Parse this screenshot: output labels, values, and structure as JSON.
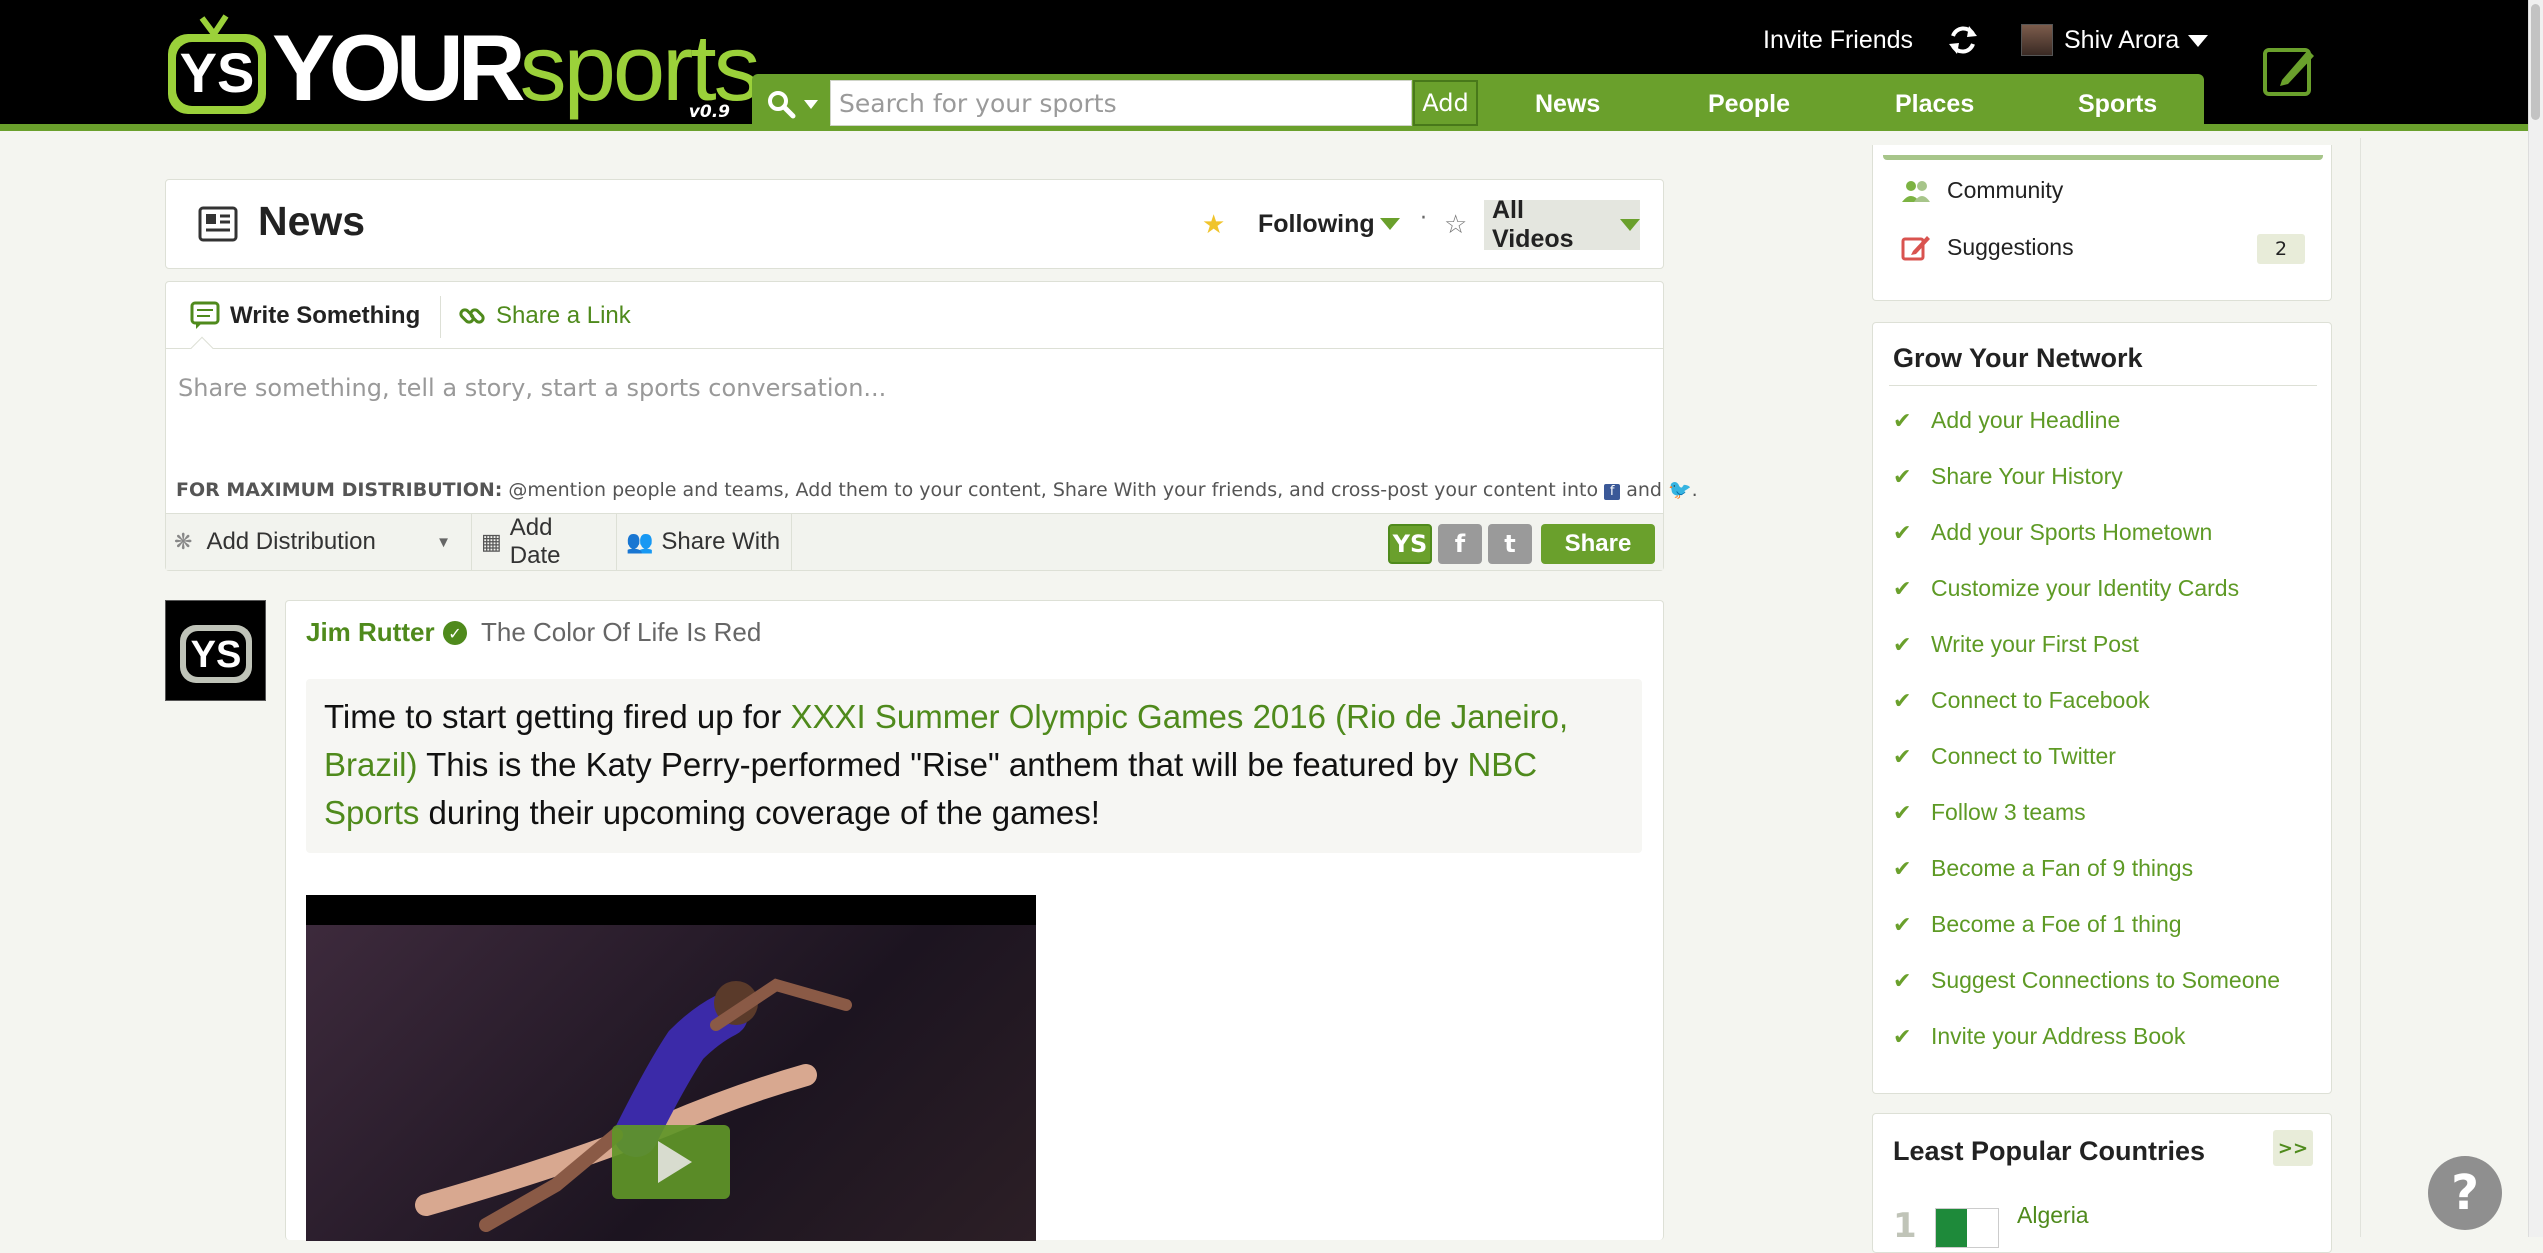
{
  "header": {
    "logo_your": "YOUR",
    "logo_sports": "sports",
    "logo_version": "v0.9",
    "search_placeholder": "Search for your sports",
    "add_label": "Add",
    "nav": [
      "News",
      "People",
      "Places",
      "Sports"
    ],
    "invite_label": "Invite Friends",
    "user_name": "Shiv Arora",
    "icons": [
      "search-icon",
      "refresh-icon",
      "compose-icon"
    ]
  },
  "feed_header": {
    "title": "News",
    "following_label": "Following",
    "separator": "·",
    "filter_label": "All Videos"
  },
  "composer": {
    "tab_write": "Write Something",
    "tab_link": "Share a Link",
    "placeholder": "Share something, tell a story, start a sports conversation...",
    "max_dist_prefix": "FOR MAXIMUM DISTRIBUTION:",
    "max_dist_text": "@mention people and teams, Add them to your content, Share With your friends, and cross-post your content into",
    "max_dist_and": "and",
    "add_distribution": "Add Distribution",
    "add_date": "Add Date",
    "share_with": "Share With",
    "share_button": "Share"
  },
  "post": {
    "author": "Jim Rutter",
    "title": "The Color Of Life Is Red",
    "body_1": "Time to start getting fired up for ",
    "link_1": "XXXI Summer Olympic Games 2016 (Rio de Janeiro, Brazil)",
    "body_2": " This is the Katy Perry-performed \"Rise\" anthem that will be featured by ",
    "link_2": "NBC Sports",
    "body_3": " during their upcoming coverage of the games!"
  },
  "sidebar": {
    "menu": [
      {
        "label": "Community",
        "icon": "community-icon"
      },
      {
        "label": "Suggestions",
        "icon": "suggestions-icon",
        "count": "2"
      }
    ],
    "grow_title": "Grow Your Network",
    "grow_items": [
      "Add your Headline",
      "Share Your History",
      "Add your Sports Hometown",
      "Customize your Identity Cards",
      "Write your First Post",
      "Connect to Facebook",
      "Connect to Twitter",
      "Follow 3 teams",
      "Become a Fan of 9 things",
      "Become a Foe of 1 thing",
      "Suggest Connections to Someone",
      "Invite your Address Book"
    ],
    "least_title": "Least Popular Countries",
    "least_more": ">>",
    "least_rank": "1",
    "least_country": "Algeria"
  },
  "colors": {
    "brand_green": "#6aa02c",
    "link_green": "#4f8a1c",
    "star": "#f0c42c"
  }
}
